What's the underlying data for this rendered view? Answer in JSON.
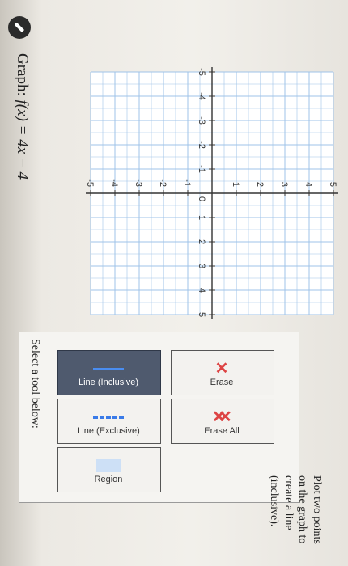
{
  "graph_title": {
    "label": "Graph: ",
    "function": "f(x) = 4x − 4"
  },
  "graph": {
    "x_min": -5,
    "x_max": 5,
    "y_min": -5,
    "y_max": 5,
    "x_ticks": [
      "-5",
      "-4",
      "-3",
      "-2",
      "-1",
      "0",
      "1",
      "2",
      "3",
      "4",
      "5"
    ],
    "y_ticks": [
      "5",
      "4",
      "3",
      "2",
      "1",
      "-1",
      "-2",
      "-3",
      "-4",
      "-5"
    ]
  },
  "tools": {
    "prompt": "Select a tool below:",
    "items": [
      {
        "label": "Line (Inclusive)",
        "icon": "solid-line-icon",
        "selected": true
      },
      {
        "label": "Line (Exclusive)",
        "icon": "dashed-line-icon",
        "selected": false
      },
      {
        "label": "Region",
        "icon": "region-icon",
        "selected": false
      },
      {
        "label": "Erase",
        "icon": "x-icon",
        "selected": false
      },
      {
        "label": "Erase All",
        "icon": "double-x-icon",
        "selected": false
      }
    ]
  },
  "instructions": "Plot two points on the graph to create a line (inclusive).",
  "colors": {
    "selected_tool": "#4f5a6e",
    "line": "#4a8df0",
    "erase": "#dd4444",
    "grid": "#9fc3e8"
  }
}
